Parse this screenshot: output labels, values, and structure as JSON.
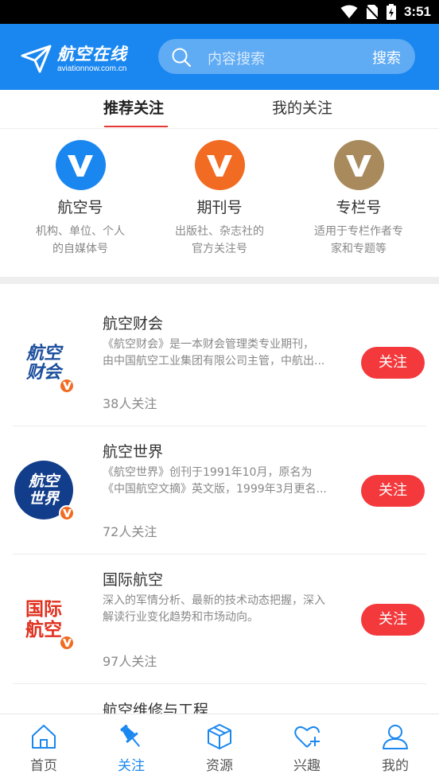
{
  "status_bar": {
    "time": "3:51"
  },
  "header": {
    "logo_title": "航空在线",
    "logo_subtitle": "aviationnow.com.cn",
    "search_placeholder": "内容搜索",
    "search_button": "搜索"
  },
  "tabs": [
    {
      "label": "推荐关注",
      "active": true
    },
    {
      "label": "我的关注",
      "active": false
    }
  ],
  "categories": [
    {
      "title": "航空号",
      "desc_line1": "机构、单位、个人",
      "desc_line2": "的自媒体号",
      "color": "#1a87f0"
    },
    {
      "title": "期刊号",
      "desc_line1": "出版社、杂志社的",
      "desc_line2": "官方关注号",
      "color": "#f26b22"
    },
    {
      "title": "专栏号",
      "desc_line1": "适用于专栏作者专",
      "desc_line2": "家和专题等",
      "color": "#a88a5c"
    }
  ],
  "list": [
    {
      "title": "航空财会",
      "avatar_text": [
        "航空",
        "财会"
      ],
      "desc_line1": "《航空财会》是一本财会管理类专业期刊，",
      "desc_line2": "由中国航空工业集团有限公司主管，中航出...",
      "count": "38人关注",
      "button": "关注"
    },
    {
      "title": "航空世界",
      "avatar_text": [
        "航空",
        "世界"
      ],
      "desc_line1": "《航空世界》创刊于1991年10月，原名为",
      "desc_line2": "《中国航空文摘》英文版，1999年3月更名...",
      "count": "72人关注",
      "button": "关注"
    },
    {
      "title": "国际航空",
      "avatar_text": [
        "国际",
        "航空"
      ],
      "desc_line1": "深入的军情分析、最新的技术动态把握，深入",
      "desc_line2": "解读行业变化趋势和市场动向。",
      "count": "97人关注",
      "button": "关注"
    },
    {
      "title": "航空维修与工程"
    }
  ],
  "bottom_nav": [
    {
      "label": "首页",
      "icon": "home-icon",
      "active": false
    },
    {
      "label": "关注",
      "icon": "pin-icon",
      "active": true
    },
    {
      "label": "资源",
      "icon": "box-icon",
      "active": false
    },
    {
      "label": "兴趣",
      "icon": "heart-plus-icon",
      "active": false
    },
    {
      "label": "我的",
      "icon": "user-icon",
      "active": false
    }
  ],
  "colors": {
    "brand_blue": "#1a87f0",
    "follow_red": "#f4393c",
    "badge_orange": "#f26b22"
  }
}
